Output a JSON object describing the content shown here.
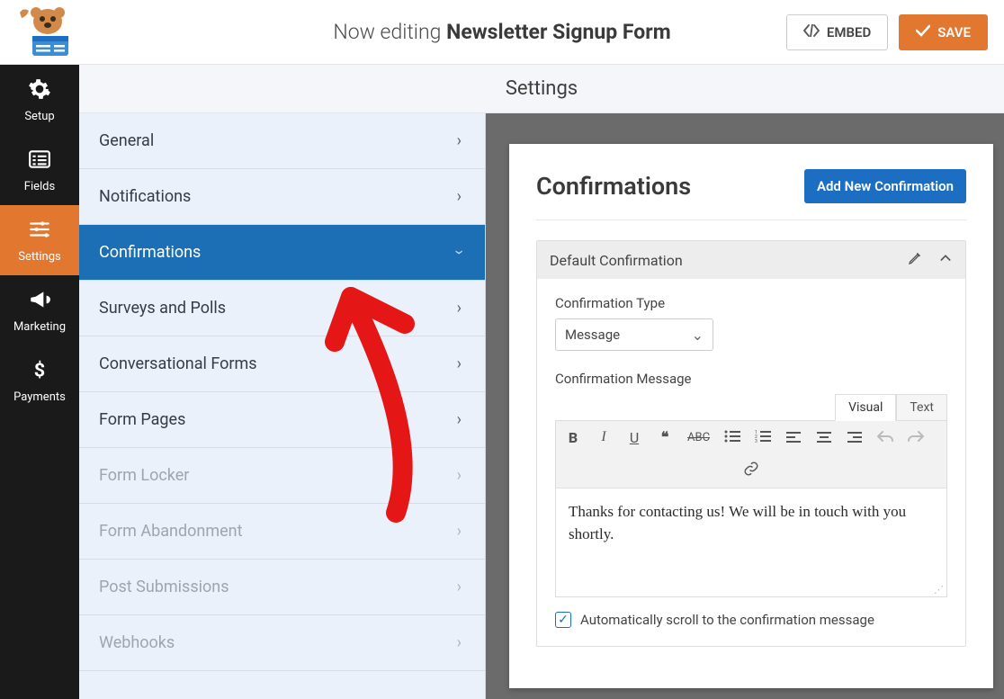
{
  "header": {
    "prefix": "Now editing",
    "form_name": "Newsletter Signup Form",
    "embed_label": "EMBED",
    "save_label": "SAVE"
  },
  "sidebar": {
    "items": [
      {
        "label": "Setup"
      },
      {
        "label": "Fields"
      },
      {
        "label": "Settings"
      },
      {
        "label": "Marketing"
      },
      {
        "label": "Payments"
      }
    ]
  },
  "settings": {
    "section_title": "Settings",
    "items": [
      {
        "label": "General",
        "active": false,
        "disabled": false
      },
      {
        "label": "Notifications",
        "active": false,
        "disabled": false
      },
      {
        "label": "Confirmations",
        "active": true,
        "disabled": false
      },
      {
        "label": "Surveys and Polls",
        "active": false,
        "disabled": false
      },
      {
        "label": "Conversational Forms",
        "active": false,
        "disabled": false
      },
      {
        "label": "Form Pages",
        "active": false,
        "disabled": false
      },
      {
        "label": "Form Locker",
        "active": false,
        "disabled": true
      },
      {
        "label": "Form Abandonment",
        "active": false,
        "disabled": true
      },
      {
        "label": "Post Submissions",
        "active": false,
        "disabled": true
      },
      {
        "label": "Webhooks",
        "active": false,
        "disabled": true
      }
    ]
  },
  "panel": {
    "title": "Confirmations",
    "add_label": "Add New Confirmation",
    "card_title": "Default Confirmation",
    "type_label": "Confirmation Type",
    "type_value": "Message",
    "message_label": "Confirmation Message",
    "tab_visual": "Visual",
    "tab_text": "Text",
    "message_value": "Thanks for contacting us! We will be in touch with you shortly.",
    "autoscroll_label": "Automatically scroll to the confirmation message",
    "autoscroll_checked": true
  },
  "colors": {
    "accent_orange": "#e27730",
    "accent_blue": "#1b6ec2",
    "annotation_red": "#e51616"
  }
}
